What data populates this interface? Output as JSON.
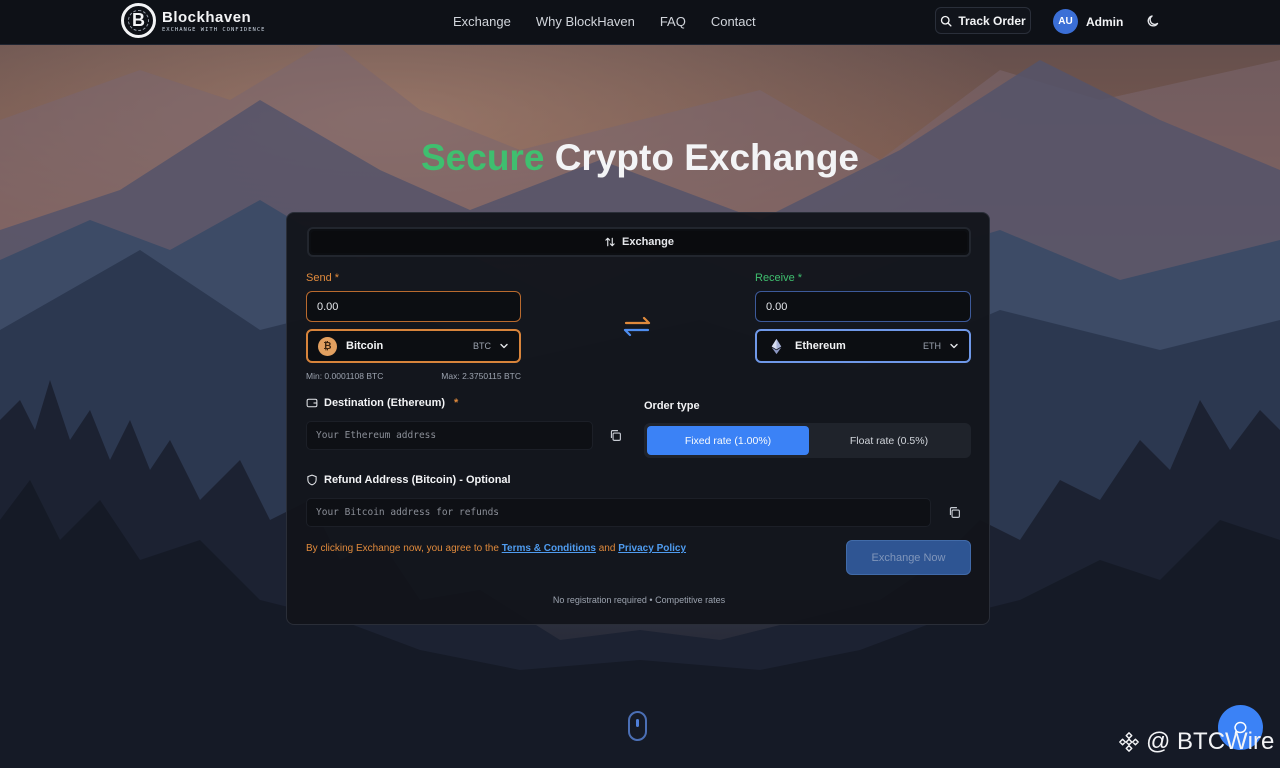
{
  "header": {
    "brand": "Blockhaven",
    "tagline": "EXCHANGE WITH CONFIDENCE",
    "logo_glyph": "B",
    "nav": [
      {
        "label": "Exchange"
      },
      {
        "label": "Why BlockHaven"
      },
      {
        "label": "FAQ"
      },
      {
        "label": "Contact"
      }
    ],
    "track_order_label": "Track Order",
    "user_initials": "AU",
    "user_name": "Admin",
    "theme_icon": "moon-icon"
  },
  "hero": {
    "title_accent": "Secure",
    "title_rest": " Crypto Exchange"
  },
  "exchange_card": {
    "tab_label": "Exchange",
    "send": {
      "label": "Send",
      "required_mark": "*",
      "amount": "0.00",
      "coin_name": "Bitcoin",
      "coin_ticker": "BTC",
      "coin_glyph": "₿",
      "min": "Min: 0.0001108 BTC",
      "max": "Max: 2.3750115 BTC"
    },
    "receive": {
      "label": "Receive",
      "required_mark": "*",
      "amount": "0.00",
      "coin_name": "Ethereum",
      "coin_ticker": "ETH"
    },
    "destination": {
      "label": "Destination (Ethereum)",
      "required_mark": "*",
      "placeholder": "Your Ethereum address"
    },
    "order_type": {
      "label": "Order type",
      "options": [
        {
          "label": "Fixed rate (1.00%)",
          "selected": true
        },
        {
          "label": "Float rate (0.5%)",
          "selected": false
        }
      ]
    },
    "refund": {
      "label": "Refund Address (Bitcoin) - Optional",
      "placeholder": "Your Bitcoin address for refunds"
    },
    "terms": {
      "prefix": "By clicking Exchange now, you agree to the ",
      "terms_link": "Terms & Conditions",
      "and": " and ",
      "privacy_link": "Privacy Policy"
    },
    "submit_label": "Exchange Now",
    "footnote": "No registration required • Competitive rates"
  },
  "watermark": {
    "text": "@ BTCWire"
  },
  "colors": {
    "accent_green": "#3fbf6f",
    "send_orange": "#e08a3c",
    "primary_blue": "#3b82f6",
    "header_bg": "#0e1117",
    "card_bg": "#12141a"
  }
}
